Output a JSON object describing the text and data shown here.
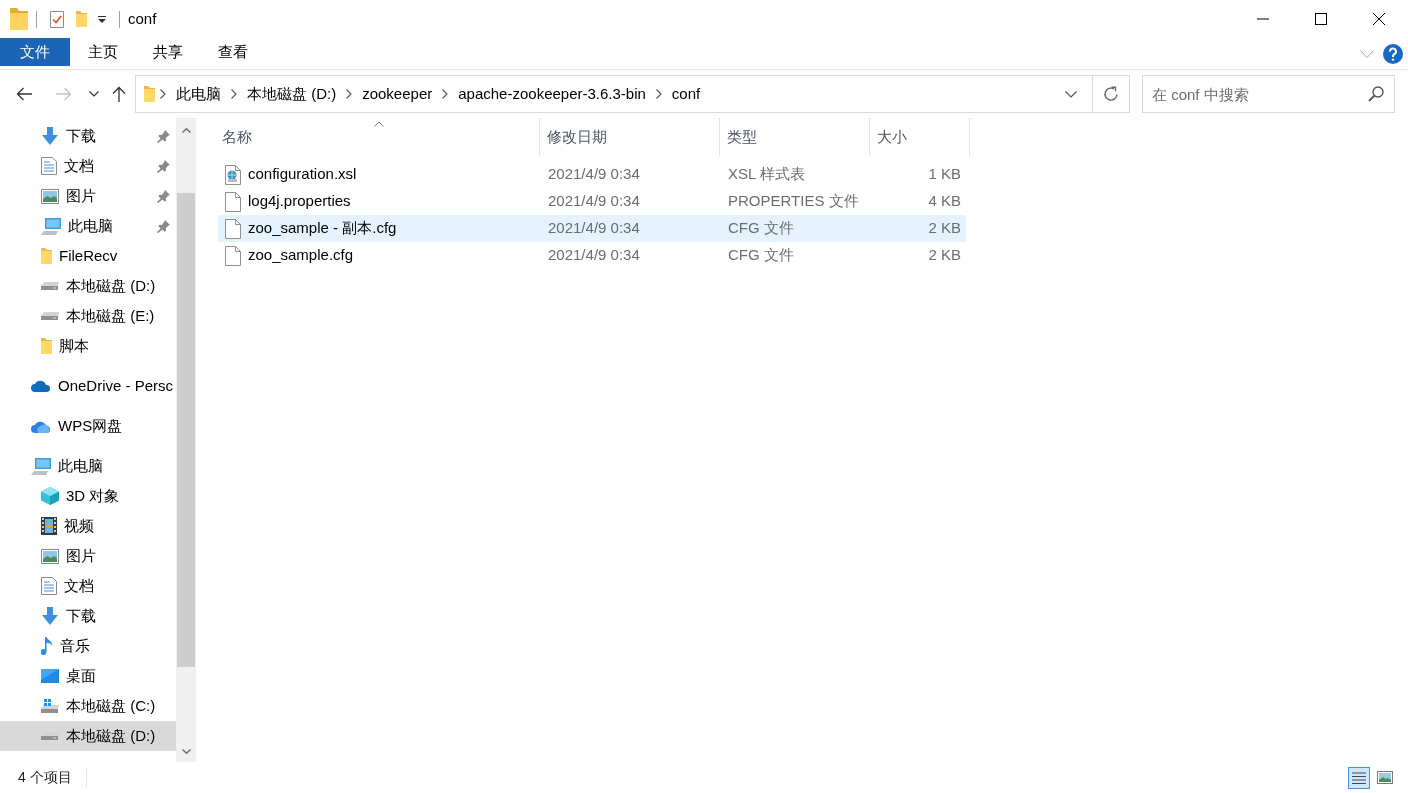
{
  "window": {
    "title": "conf"
  },
  "ribbon": {
    "tabs": [
      {
        "label": "文件",
        "kind": "file"
      },
      {
        "label": "主页",
        "kind": "tab"
      },
      {
        "label": "共享",
        "kind": "tab"
      },
      {
        "label": "查看",
        "kind": "tab"
      }
    ]
  },
  "navigation": [
    {
      "kind": "back",
      "disabled": false
    },
    {
      "kind": "forward",
      "disabled": true
    },
    {
      "kind": "recent",
      "disabled": false
    },
    {
      "kind": "up",
      "disabled": false
    }
  ],
  "address_bar": {
    "crumbs": [
      "此电脑",
      "本地磁盘 (D:)",
      "zookeeper",
      "apache-zookeeper-3.6.3-bin",
      "conf"
    ]
  },
  "search": {
    "placeholder": "在 conf 中搜索"
  },
  "sidebar": {
    "quick_access": [
      {
        "label": "下载",
        "kind": "download",
        "pinned": true,
        "selected": false
      },
      {
        "label": "文档",
        "kind": "document",
        "pinned": true,
        "selected": false
      },
      {
        "label": "图片",
        "kind": "picture",
        "pinned": true,
        "selected": false
      },
      {
        "label": "此电脑",
        "kind": "computer",
        "pinned": true,
        "selected": false
      },
      {
        "label": "FileRecv",
        "kind": "folder",
        "pinned": false,
        "selected": false
      },
      {
        "label": "本地磁盘 (D:)",
        "kind": "drive",
        "pinned": false,
        "selected": false
      },
      {
        "label": "本地磁盘 (E:)",
        "kind": "drive",
        "pinned": false,
        "selected": false
      },
      {
        "label": "脚本",
        "kind": "folder",
        "pinned": false,
        "selected": false
      }
    ],
    "tree": [
      {
        "label": "OneDrive - Persc",
        "kind": "onedrive",
        "selected": false
      },
      {
        "label": "WPS网盘",
        "kind": "cloud",
        "selected": false
      },
      {
        "label": "此电脑",
        "kind": "computer",
        "selected": false,
        "children": [
          {
            "label": "3D 对象",
            "kind": "cube",
            "selected": false
          },
          {
            "label": "视频",
            "kind": "video",
            "selected": false
          },
          {
            "label": "图片",
            "kind": "picture",
            "selected": false
          },
          {
            "label": "文档",
            "kind": "document",
            "selected": false
          },
          {
            "label": "下载",
            "kind": "download",
            "selected": false
          },
          {
            "label": "音乐",
            "kind": "music",
            "selected": false
          },
          {
            "label": "桌面",
            "kind": "desktop",
            "selected": false
          },
          {
            "label": "本地磁盘 (C:)",
            "kind": "drive-windows",
            "selected": false
          },
          {
            "label": "本地磁盘 (D:)",
            "kind": "drive",
            "selected": true
          }
        ]
      }
    ]
  },
  "file_list": {
    "columns": [
      {
        "label": "名称",
        "sorted": true
      },
      {
        "label": "修改日期",
        "sorted": false
      },
      {
        "label": "类型",
        "sorted": false
      },
      {
        "label": "大小",
        "sorted": false
      }
    ],
    "rows": [
      {
        "name": "configuration.xsl",
        "modified": "2021/4/9 0:34",
        "type": "XSL 样式表",
        "size": "1 KB",
        "kind": "xsl",
        "hovered": false
      },
      {
        "name": "log4j.properties",
        "modified": "2021/4/9 0:34",
        "type": "PROPERTIES 文件",
        "size": "4 KB",
        "kind": "file",
        "hovered": false
      },
      {
        "name": "zoo_sample - 副本.cfg",
        "modified": "2021/4/9 0:34",
        "type": "CFG 文件",
        "size": "2 KB",
        "kind": "file",
        "hovered": true
      },
      {
        "name": "zoo_sample.cfg",
        "modified": "2021/4/9 0:34",
        "type": "CFG 文件",
        "size": "2 KB",
        "kind": "file",
        "hovered": false
      }
    ]
  },
  "status_bar": {
    "item_count": "4 个项目",
    "views": [
      {
        "kind": "details",
        "selected": true
      },
      {
        "kind": "large-icons",
        "selected": false
      }
    ]
  }
}
